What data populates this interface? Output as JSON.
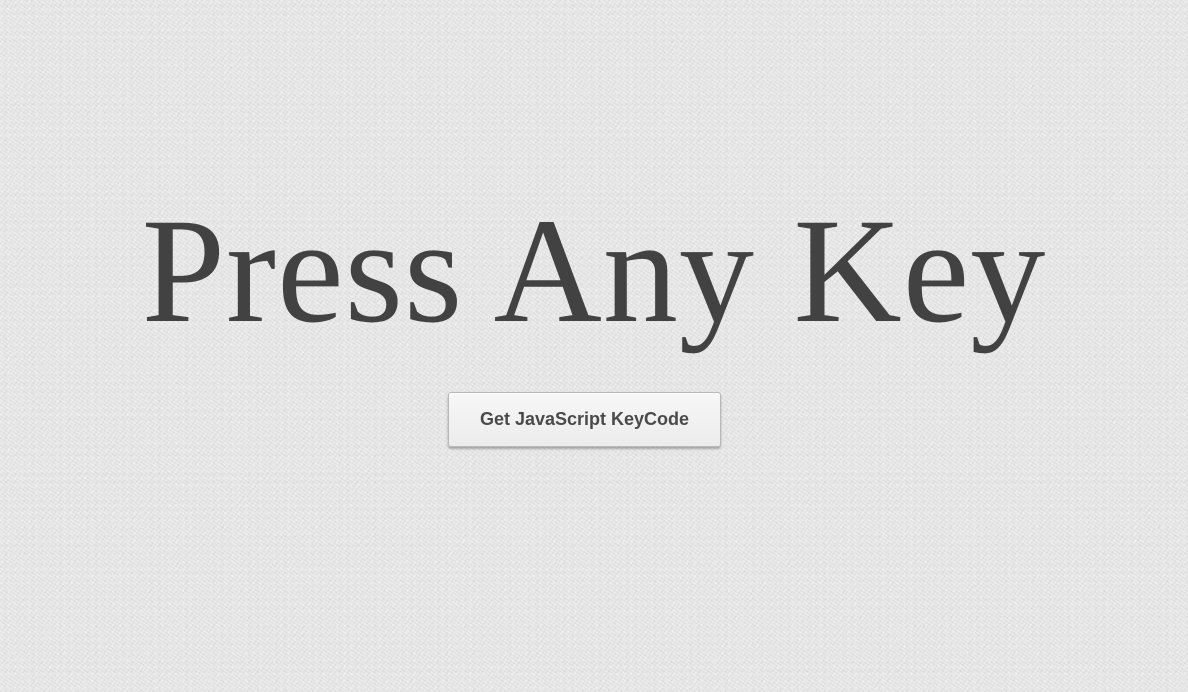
{
  "main": {
    "heading": "Press Any Key",
    "button_label": "Get JavaScript KeyCode"
  },
  "colors": {
    "background": "#e6e6e6",
    "heading_text": "#424242",
    "button_text": "#4a4a4a"
  }
}
